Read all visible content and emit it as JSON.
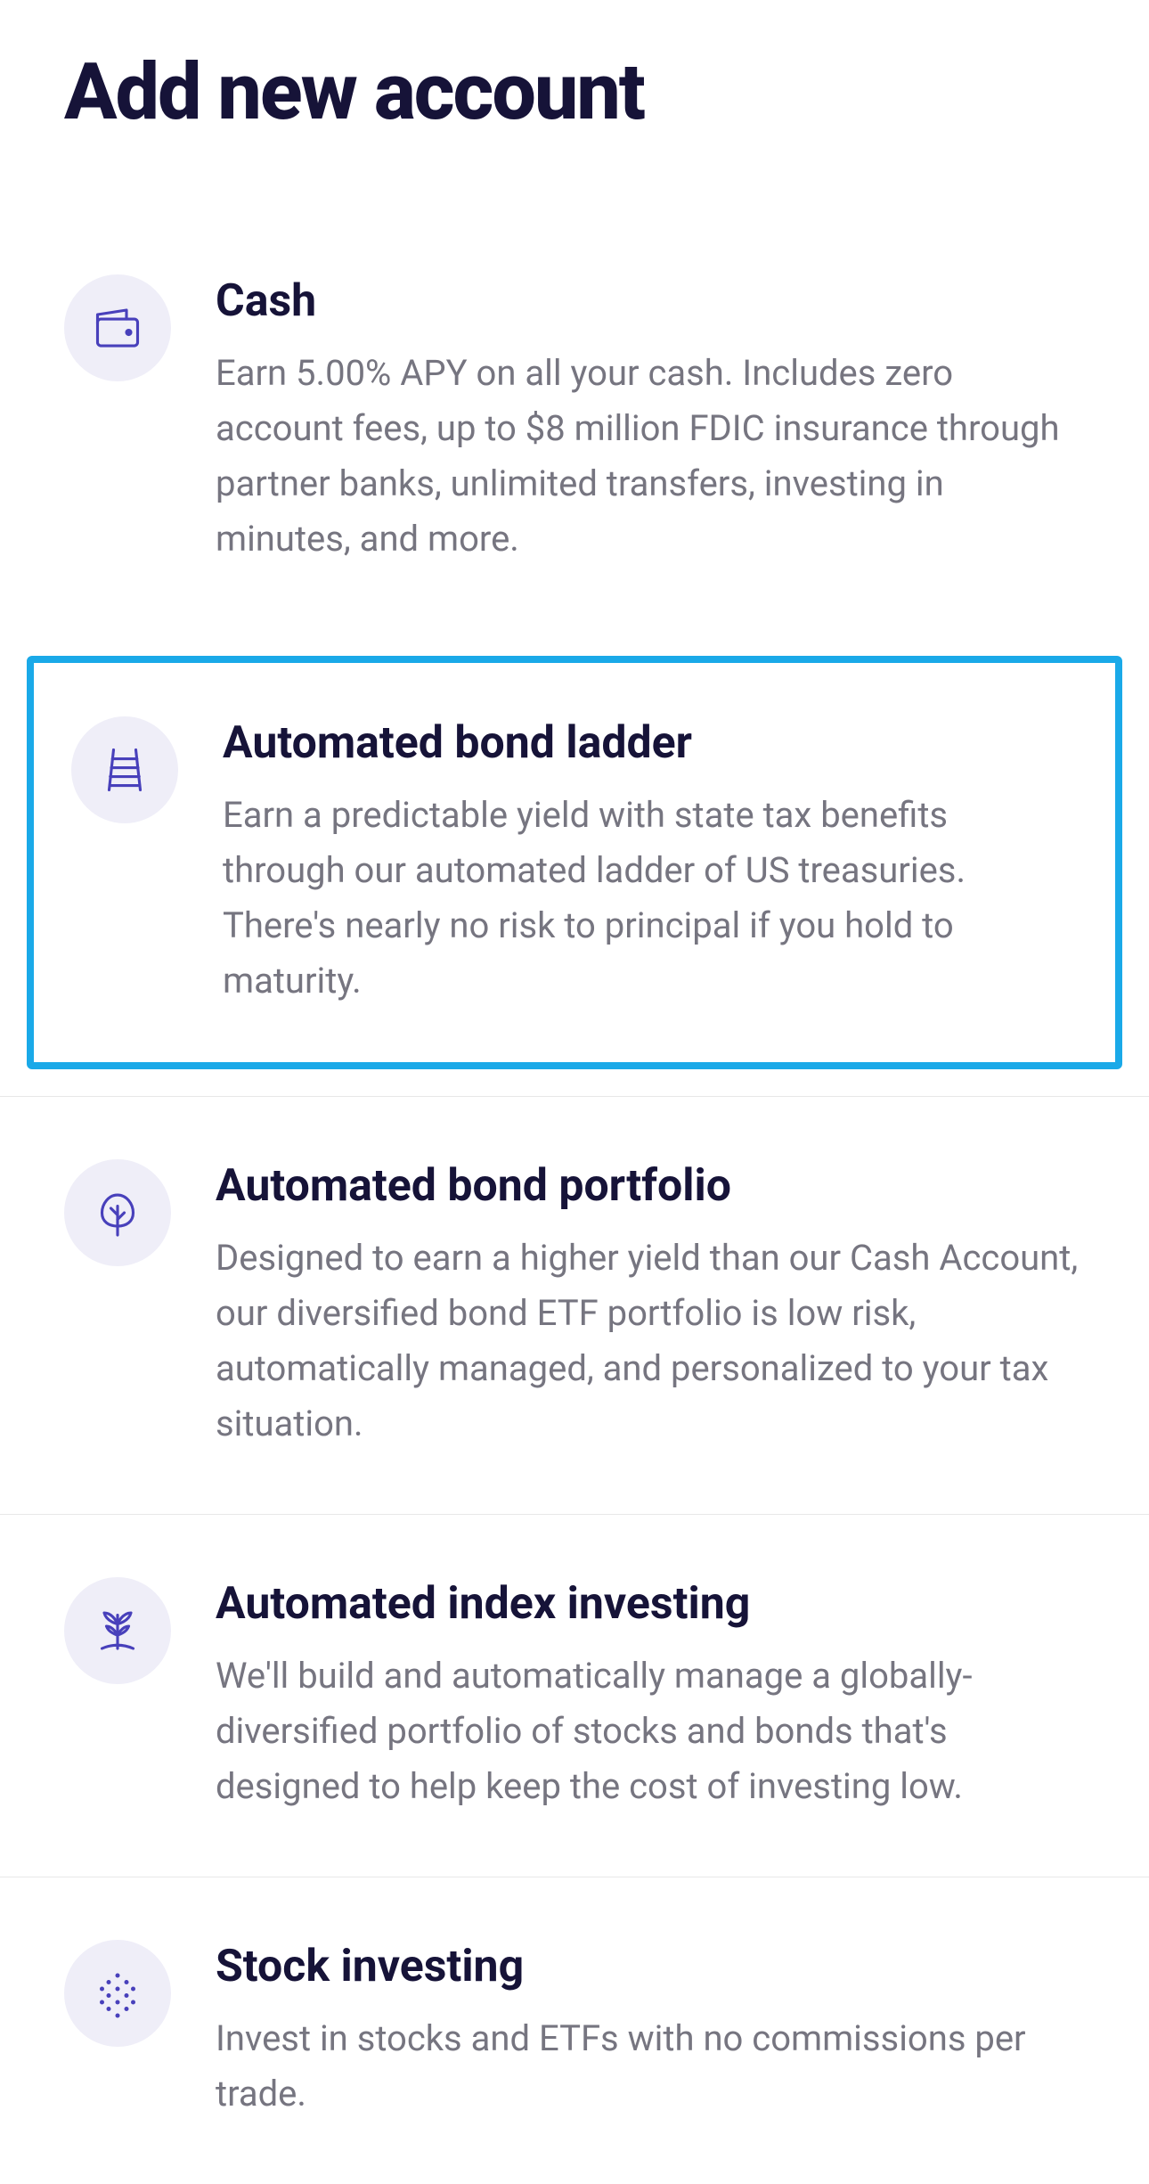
{
  "page": {
    "title": "Add new account"
  },
  "accounts": [
    {
      "icon": "wallet-icon",
      "title": "Cash",
      "description": "Earn 5.00% APY on all your cash. Includes zero account fees, up to $8 million FDIC insurance through partner banks, unlimited transfers, investing in minutes, and more.",
      "selected": false
    },
    {
      "icon": "ladder-icon",
      "title": "Automated bond ladder",
      "description": "Earn a predictable yield with state tax benefits through our automated ladder of US treasuries. There's nearly no risk to principal if you hold to maturity.",
      "selected": true
    },
    {
      "icon": "tree-icon",
      "title": "Automated bond portfolio",
      "description": "Designed to earn a higher yield than our Cash Account, our diversified bond ETF portfolio is low risk, automatically managed, and personalized to your tax situation.",
      "selected": false
    },
    {
      "icon": "plant-icon",
      "title": "Automated index investing",
      "description": "We'll build and automatically manage a globally-diversified portfolio of stocks and bonds that's designed to help keep the cost of investing low.",
      "selected": false
    },
    {
      "icon": "dots-icon",
      "title": "Stock investing",
      "description": "Invest in stocks and ETFs with no commissions per trade.",
      "selected": false
    }
  ]
}
